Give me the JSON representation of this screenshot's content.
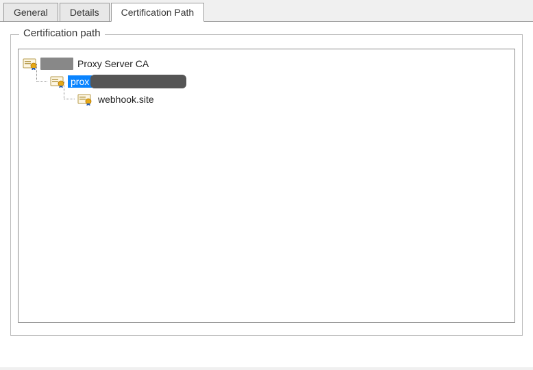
{
  "tabs": {
    "general": "General",
    "details": "Details",
    "certpath": "Certification Path"
  },
  "fieldset_title": "Certification path",
  "tree": {
    "root": {
      "label_visible": "Proxy Server CA",
      "redacted_prefix": true
    },
    "intermediate": {
      "label_visible": "prox",
      "redacted_suffix": true,
      "selected": true
    },
    "leaf": {
      "label": "webhook.site"
    }
  }
}
